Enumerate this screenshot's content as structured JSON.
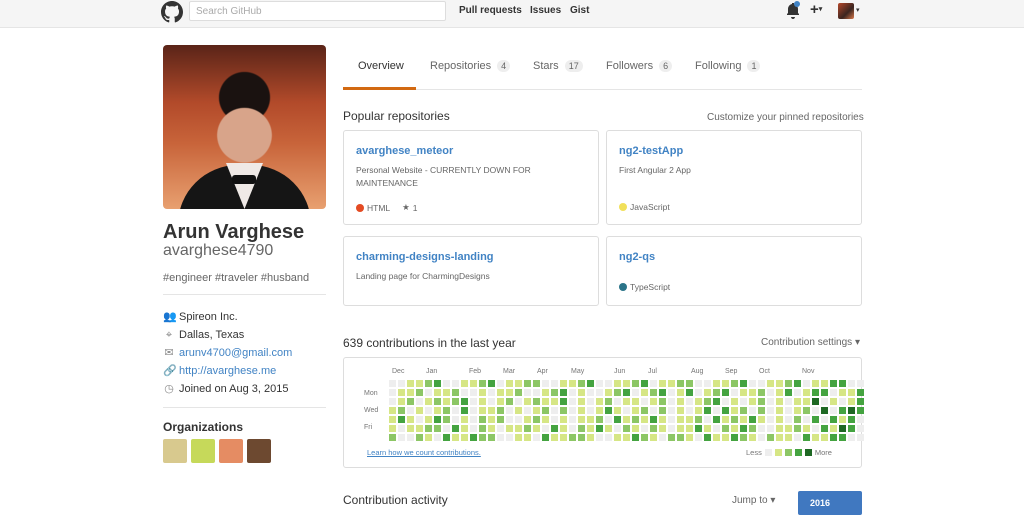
{
  "header": {
    "search_placeholder": "Search GitHub",
    "nav": [
      "Pull requests",
      "Issues",
      "Gist"
    ],
    "plus_label": "+",
    "caret": "▾"
  },
  "profile": {
    "full_name": "Arun Varghese",
    "username": "avarghese4790",
    "bio": "#engineer #traveler #husband",
    "company": "Spireon Inc.",
    "location": "Dallas, Texas",
    "email": "arunv4700@gmail.com",
    "website": "http://avarghese.me",
    "joined": "Joined on Aug 3, 2015",
    "organizations_title": "Organizations",
    "org_colors": [
      "#d8c98e",
      "#c6d95a",
      "#e58c63",
      "#6d4930"
    ]
  },
  "tabs": [
    {
      "label": "Overview",
      "count": ""
    },
    {
      "label": "Repositories",
      "count": "4"
    },
    {
      "label": "Stars",
      "count": "17"
    },
    {
      "label": "Followers",
      "count": "6"
    },
    {
      "label": "Following",
      "count": "1"
    }
  ],
  "popular": {
    "title": "Popular repositories",
    "customize": "Customize your pinned repositories",
    "repos": [
      {
        "name": "avarghese_meteor",
        "description": "Personal Website - CURRENTLY DOWN FOR MAINTENANCE",
        "language": "HTML",
        "language_color": "#e44b23",
        "stars": "1"
      },
      {
        "name": "ng2-testApp",
        "description": "First Angular 2 App",
        "language": "JavaScript",
        "language_color": "#f1e05a",
        "stars": ""
      },
      {
        "name": "charming-designs-landing",
        "description": "Landing page for CharmingDesigns",
        "language": "",
        "language_color": "",
        "stars": ""
      },
      {
        "name": "ng2-qs",
        "description": "",
        "language": "TypeScript",
        "language_color": "#2b7489",
        "stars": ""
      }
    ]
  },
  "contributions": {
    "title": "639 contributions in the last year",
    "settings": "Contribution settings",
    "months": [
      "Dec",
      "Jan",
      "Feb",
      "Mar",
      "Apr",
      "May",
      "Jun",
      "Jul",
      "Aug",
      "Sep",
      "Oct",
      "Nov"
    ],
    "days": [
      "Mon",
      "Wed",
      "Fri"
    ],
    "learn_link": "Learn how we count contributions.",
    "less": "Less",
    "more": "More",
    "palette": [
      "#eeeeee",
      "#d6e685",
      "#8cc665",
      "#44a340",
      "#1e6823"
    ]
  },
  "activity": {
    "title": "Contribution activity",
    "jump_to": "Jump to",
    "year": "2016"
  }
}
